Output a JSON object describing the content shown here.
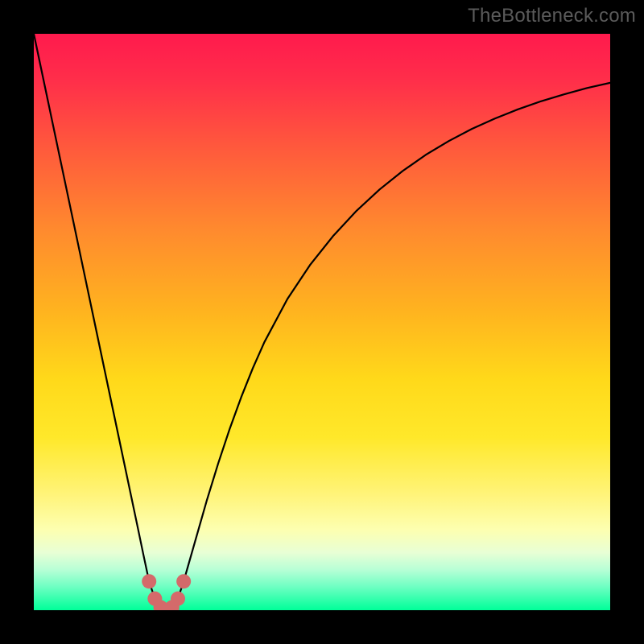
{
  "watermark": "TheBottleneck.com",
  "colors": {
    "frame": "#000000",
    "curve": "#000000",
    "marker": "#d46a6a",
    "gradient_top": "#ff1a4d",
    "gradient_bottom": "#00ff99"
  },
  "chart_data": {
    "type": "line",
    "title": "",
    "xlabel": "",
    "ylabel": "",
    "xlim": [
      0,
      100
    ],
    "ylim": [
      0,
      100
    ],
    "x": [
      0,
      2,
      4,
      6,
      8,
      10,
      12,
      14,
      16,
      18,
      19,
      20,
      21,
      22,
      23,
      24,
      25,
      26,
      28,
      30,
      32,
      34,
      36,
      38,
      40,
      44,
      48,
      52,
      56,
      60,
      64,
      68,
      72,
      76,
      80,
      84,
      88,
      92,
      96,
      100
    ],
    "values": [
      100,
      90.5,
      81,
      71.5,
      62,
      52.5,
      43,
      33.5,
      24,
      14.5,
      9.7,
      5,
      2,
      0.5,
      0,
      0.5,
      2,
      5,
      12,
      19,
      25.5,
      31.5,
      37,
      42,
      46.5,
      54,
      60,
      65,
      69.3,
      73,
      76.2,
      79,
      81.4,
      83.5,
      85.3,
      86.9,
      88.3,
      89.5,
      90.6,
      91.5
    ],
    "minimum_x": 23,
    "minimum_y": 0,
    "series": [
      {
        "name": "bottleneck-curve",
        "x": [
          0,
          2,
          4,
          6,
          8,
          10,
          12,
          14,
          16,
          18,
          19,
          20,
          21,
          22,
          23,
          24,
          25,
          26,
          28,
          30,
          32,
          34,
          36,
          38,
          40,
          44,
          48,
          52,
          56,
          60,
          64,
          68,
          72,
          76,
          80,
          84,
          88,
          92,
          96,
          100
        ],
        "y": [
          100,
          90.5,
          81,
          71.5,
          62,
          52.5,
          43,
          33.5,
          24,
          14.5,
          9.7,
          5,
          2,
          0.5,
          0,
          0.5,
          2,
          5,
          12,
          19,
          25.5,
          31.5,
          37,
          42,
          46.5,
          54,
          60,
          65,
          69.3,
          73,
          76.2,
          79,
          81.4,
          83.5,
          85.3,
          86.9,
          88.3,
          89.5,
          90.6,
          91.5
        ]
      }
    ],
    "markers": [
      {
        "x": 20,
        "y": 5
      },
      {
        "x": 21,
        "y": 2
      },
      {
        "x": 22,
        "y": 0.5
      },
      {
        "x": 23,
        "y": 0
      },
      {
        "x": 24,
        "y": 0.5
      },
      {
        "x": 25,
        "y": 2
      },
      {
        "x": 26,
        "y": 5
      }
    ]
  }
}
